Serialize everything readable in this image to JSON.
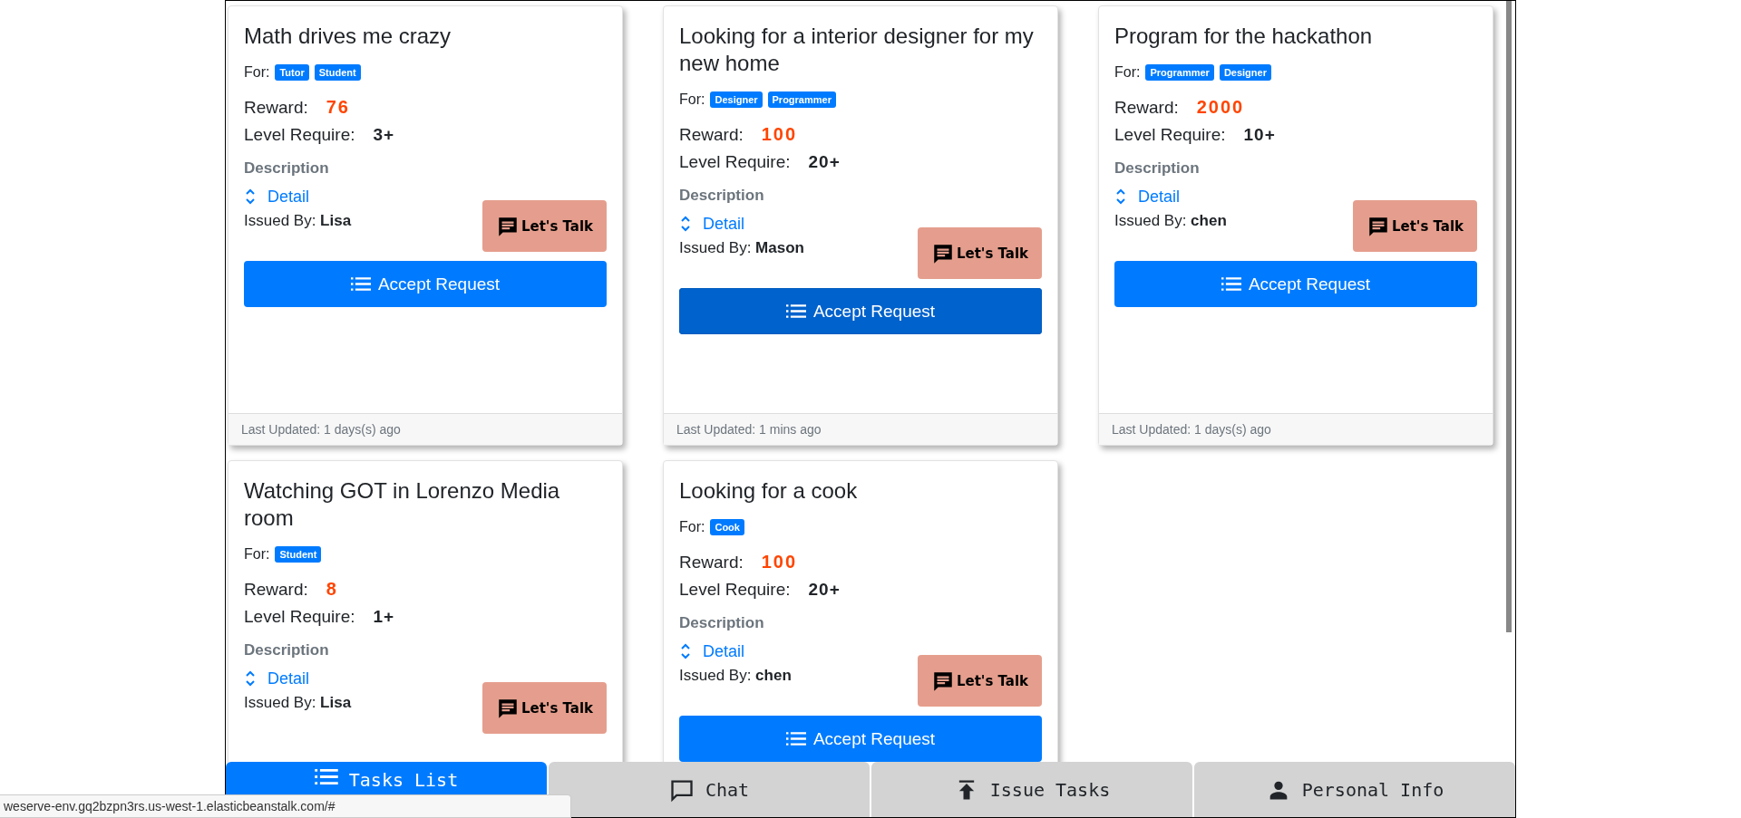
{
  "cards": [
    {
      "title": "Math drives me crazy",
      "for_label": "For:",
      "tags": [
        "Tutor",
        "Student"
      ],
      "reward_label": "Reward:",
      "reward": "76",
      "level_label": "Level Require:",
      "level": "3+",
      "description_label": "Description",
      "detail": "Detail",
      "issued_label": "Issued By:",
      "issuer": "Lisa",
      "talk": "Let's Talk",
      "accept": "Accept Request",
      "highlighted": false,
      "updated": "Last Updated: 1 days(s) ago"
    },
    {
      "title": "Looking for a interior designer for my new home",
      "for_label": "For:",
      "tags": [
        "Designer",
        "Programmer"
      ],
      "reward_label": "Reward:",
      "reward": "100",
      "level_label": "Level Require:",
      "level": "20+",
      "description_label": "Description",
      "detail": "Detail",
      "issued_label": "Issued By:",
      "issuer": "Mason",
      "talk": "Let's Talk",
      "accept": "Accept Request",
      "highlighted": true,
      "updated": "Last Updated: 1 mins ago"
    },
    {
      "title": "Program for the hackathon",
      "for_label": "For:",
      "tags": [
        "Programmer",
        "Designer"
      ],
      "reward_label": "Reward:",
      "reward": "2000",
      "level_label": "Level Require:",
      "level": "10+",
      "description_label": "Description",
      "detail": "Detail",
      "issued_label": "Issued By:",
      "issuer": "chen",
      "talk": "Let's Talk",
      "accept": "Accept Request",
      "highlighted": false,
      "updated": "Last Updated: 1 days(s) ago"
    },
    {
      "title": "Watching GOT in Lorenzo Media room",
      "for_label": "For:",
      "tags": [
        "Student"
      ],
      "reward_label": "Reward:",
      "reward": "8",
      "level_label": "Level Require:",
      "level": "1+",
      "description_label": "Description",
      "detail": "Detail",
      "issued_label": "Issued By:",
      "issuer": "Lisa",
      "talk": "Let's Talk"
    },
    {
      "title": "Looking for a cook",
      "for_label": "For:",
      "tags": [
        "Cook"
      ],
      "reward_label": "Reward:",
      "reward": "100",
      "level_label": "Level Require:",
      "level": "20+",
      "description_label": "Description",
      "detail": "Detail",
      "issued_label": "Issued By:",
      "issuer": "chen",
      "talk": "Let's Talk",
      "accept": "Accept Request",
      "highlighted": false
    }
  ],
  "nav": [
    {
      "kind": "list",
      "label": "Tasks List",
      "selected": true
    },
    {
      "kind": "chat",
      "label": "Chat",
      "selected": false
    },
    {
      "kind": "upload",
      "label": "Issue Tasks",
      "selected": false
    },
    {
      "kind": "person",
      "label": "Personal Info",
      "selected": false
    }
  ],
  "status_url": "weserve-env.gq2bzpn3rs.us-west-1.elasticbeanstalk.com/#"
}
